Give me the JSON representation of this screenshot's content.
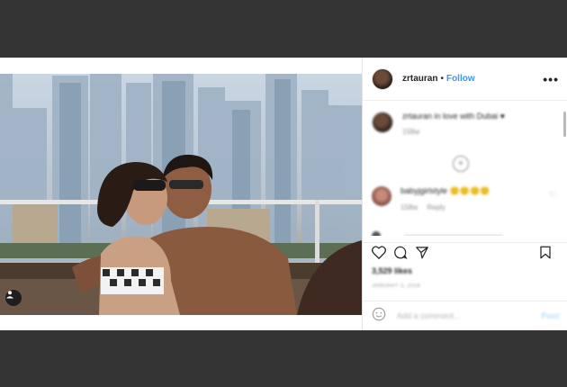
{
  "post": {
    "username": "zrtauran",
    "separator": "•",
    "follow_label": "Follow",
    "more_label": "•••",
    "caption": {
      "username": "zrtauran",
      "text": "in love with Dubai",
      "time": "158w"
    },
    "load_more_label": "+",
    "comment": {
      "username": "babyjgirlstyle",
      "text": "🙂🙂🙂🙂",
      "time": "158w",
      "reply_label": "Reply"
    },
    "likes": "3,529 likes",
    "date": "JANUARY 3, 2018",
    "add_comment_placeholder": "Add a comment...",
    "post_button": "Post"
  },
  "icons": {
    "like": "heart-icon",
    "comment": "comment-bubble-icon",
    "share": "share-icon",
    "save": "bookmark-icon",
    "user_tag": "user-tag-icon",
    "emoji": "emoji-icon"
  },
  "colors": {
    "backdrop": "#333333",
    "link": "#3897f0",
    "text": "#262626",
    "muted": "#8e8e8e"
  }
}
